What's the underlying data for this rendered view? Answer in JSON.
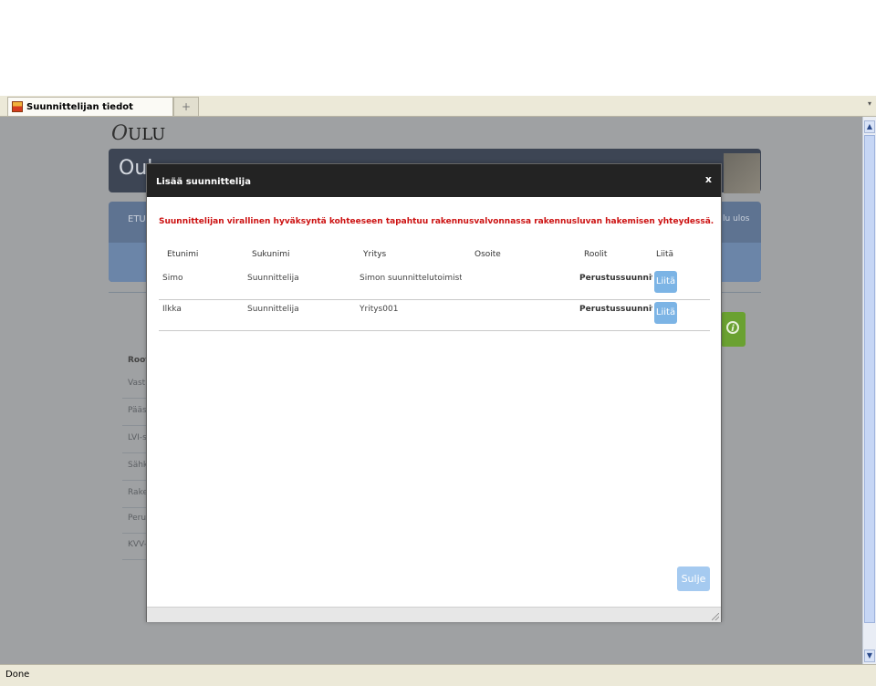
{
  "browser": {
    "tab_title": "Suunnittelijan tiedot",
    "new_tab_symbol": "+",
    "tab_list_symbol": "▾",
    "status": "Done"
  },
  "page": {
    "logo_initial": "O",
    "logo_rest": "ULU",
    "banner_title": "Oul",
    "nav_left": "ETU",
    "nav_right": "lu ulos",
    "roles_heading": "Root",
    "role_items": [
      "Vast",
      "Pääs",
      "LVI-s",
      "Sähk",
      "Rake",
      "Peru",
      "KVV-"
    ]
  },
  "modal": {
    "title": "Lisää suunnittelija",
    "close_symbol": "x",
    "warning": "Suunnittelijan virallinen hyväksyntä kohteeseen tapahtuu rakennusvalvonnassa rakennusluvan hakemisen yhteydessä.",
    "columns": [
      "Etunimi",
      "Sukunimi",
      "Yritys",
      "Osoite",
      "Roolit",
      "Liitä"
    ],
    "rows": [
      {
        "etunimi": "Simo",
        "sukunimi": "Suunnittelija",
        "yritys": "Simon suunnittelutoimisto (",
        "osoite": "",
        "roolit": "Perustussuunnitt",
        "action": "Liitä"
      },
      {
        "etunimi": "Ilkka",
        "sukunimi": "Suunnittelija",
        "yritys": "Yritys001",
        "osoite": "",
        "roolit": "Perustussuunnitt",
        "action": "Liitä"
      }
    ],
    "close_button": "Sulje"
  },
  "colors": {
    "modal_header": "#232323",
    "warning_text": "#cc1111",
    "primary_button": "#7cb4e5",
    "overlay": "#9fa1a3"
  }
}
